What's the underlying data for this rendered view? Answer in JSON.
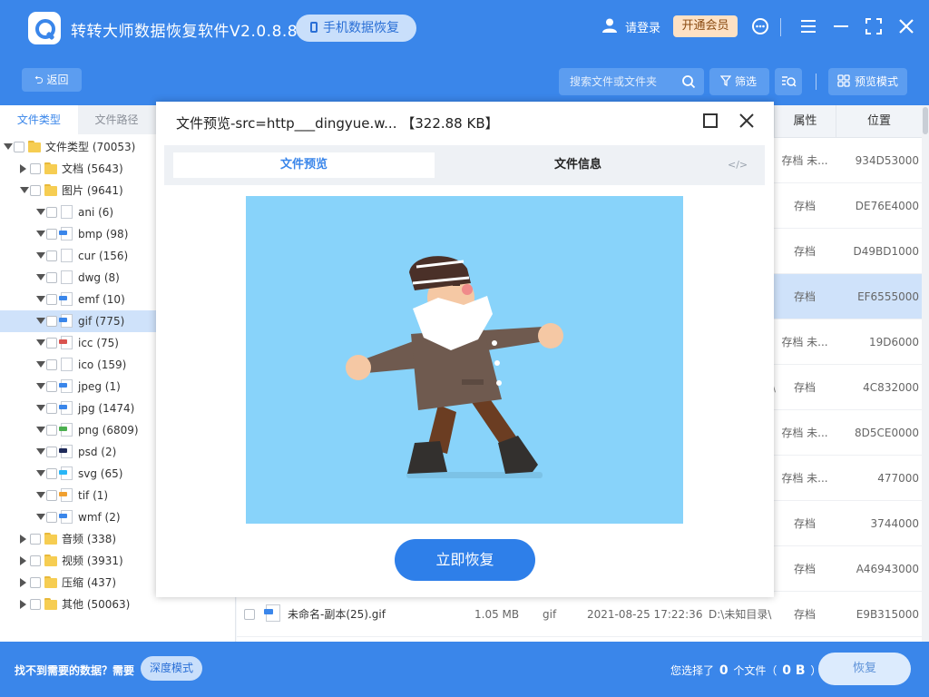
{
  "app": {
    "title": "转转大师数据恢复软件V2.0.8.8",
    "phone_recovery": "手机数据恢复",
    "login": "请登录",
    "vip": "开通会员"
  },
  "toolbar": {
    "back": "返回",
    "search_placeholder": "搜索文件或文件夹",
    "filter": "筛选",
    "preview_mode": "预览模式"
  },
  "left_tabs": [
    "文件类型",
    "文件路径"
  ],
  "tree": [
    {
      "label": "文件类型 (70053)",
      "kind": "folder",
      "level": 0,
      "open": true
    },
    {
      "label": "文档 (5643)",
      "kind": "folder",
      "level": 1,
      "open": false
    },
    {
      "label": "图片 (9641)",
      "kind": "folder",
      "level": 1,
      "open": true
    },
    {
      "label": "ani (6)",
      "kind": "file",
      "level": 2,
      "tag": ""
    },
    {
      "label": "bmp (98)",
      "kind": "file",
      "level": 2,
      "tag": "#3a86ea"
    },
    {
      "label": "cur (156)",
      "kind": "file",
      "level": 2,
      "tag": ""
    },
    {
      "label": "dwg (8)",
      "kind": "file",
      "level": 2,
      "tag": ""
    },
    {
      "label": "emf (10)",
      "kind": "file",
      "level": 2,
      "tag": "#3a86ea"
    },
    {
      "label": "gif (775)",
      "kind": "file",
      "level": 2,
      "tag": "#3a86ea",
      "selected": true
    },
    {
      "label": "icc (75)",
      "kind": "file",
      "level": 2,
      "tag": "#d9534f"
    },
    {
      "label": "ico (159)",
      "kind": "file",
      "level": 2,
      "tag": ""
    },
    {
      "label": "jpeg (1)",
      "kind": "file",
      "level": 2,
      "tag": "#3a86ea"
    },
    {
      "label": "jpg (1474)",
      "kind": "file",
      "level": 2,
      "tag": "#3a86ea"
    },
    {
      "label": "png (6809)",
      "kind": "file",
      "level": 2,
      "tag": "#4caf50"
    },
    {
      "label": "psd (2)",
      "kind": "file",
      "level": 2,
      "tag": "#1e2a5a"
    },
    {
      "label": "svg (65)",
      "kind": "file",
      "level": 2,
      "tag": "#29b6f6"
    },
    {
      "label": "tif (1)",
      "kind": "file",
      "level": 2,
      "tag": "#f0a030"
    },
    {
      "label": "wmf (2)",
      "kind": "file",
      "level": 2,
      "tag": "#3a86ea"
    },
    {
      "label": "音频 (338)",
      "kind": "folder",
      "level": 1,
      "open": false
    },
    {
      "label": "视频 (3931)",
      "kind": "folder",
      "level": 1,
      "open": false
    },
    {
      "label": "压缩 (437)",
      "kind": "folder",
      "level": 1,
      "open": false
    },
    {
      "label": "其他 (50063)",
      "kind": "folder",
      "level": 1,
      "open": false
    }
  ],
  "table": {
    "headers": {
      "attr": "属性",
      "pos": "位置"
    },
    "rows": [
      {
        "attr": "存档 未...",
        "pos": "934D53000"
      },
      {
        "attr": "存档",
        "pos": "DE76E4000"
      },
      {
        "attr": "存档",
        "pos": "D49BD1000"
      },
      {
        "attr": "存档",
        "pos": "EF6555000",
        "selected": true
      },
      {
        "attr": "存档 未...",
        "pos": "19D6000"
      },
      {
        "attr": "存档",
        "pos": "4C832000",
        "frag": "\\"
      },
      {
        "attr": "存档 未...",
        "pos": "8D5CE0000"
      },
      {
        "attr": "存档 未...",
        "pos": "477000"
      },
      {
        "attr": "存档",
        "pos": "3744000"
      },
      {
        "attr": "存档",
        "pos": "A46943000"
      }
    ],
    "last_row": {
      "name": "未命名-副本(25).gif",
      "size": "1.05 MB",
      "type": "gif",
      "date": "2021-08-25 17:22:36",
      "path": "D:\\未知目录\\",
      "attr": "存档",
      "pos": "E9B315000"
    }
  },
  "footer": {
    "not_found": "找不到需要的数据？需要",
    "deep_mode": "深度模式",
    "selected_prefix": "您选择了",
    "selected_count": "0",
    "files_label": "个文件（",
    "selected_size": "0 B",
    "close_paren": "）",
    "recover": "恢复"
  },
  "modal": {
    "title": "文件预览-src=http___dingyue.w... 【322.88 KB】",
    "tab_preview": "文件预览",
    "tab_info": "文件信息",
    "code_glyph": "</>",
    "recover_now": "立即恢复"
  },
  "colors": {
    "brand_blue": "#3a86ea",
    "preview_bg": "#88d3fa",
    "selected_row": "#cfe2fa",
    "vip_bg": "#fde1c4"
  }
}
